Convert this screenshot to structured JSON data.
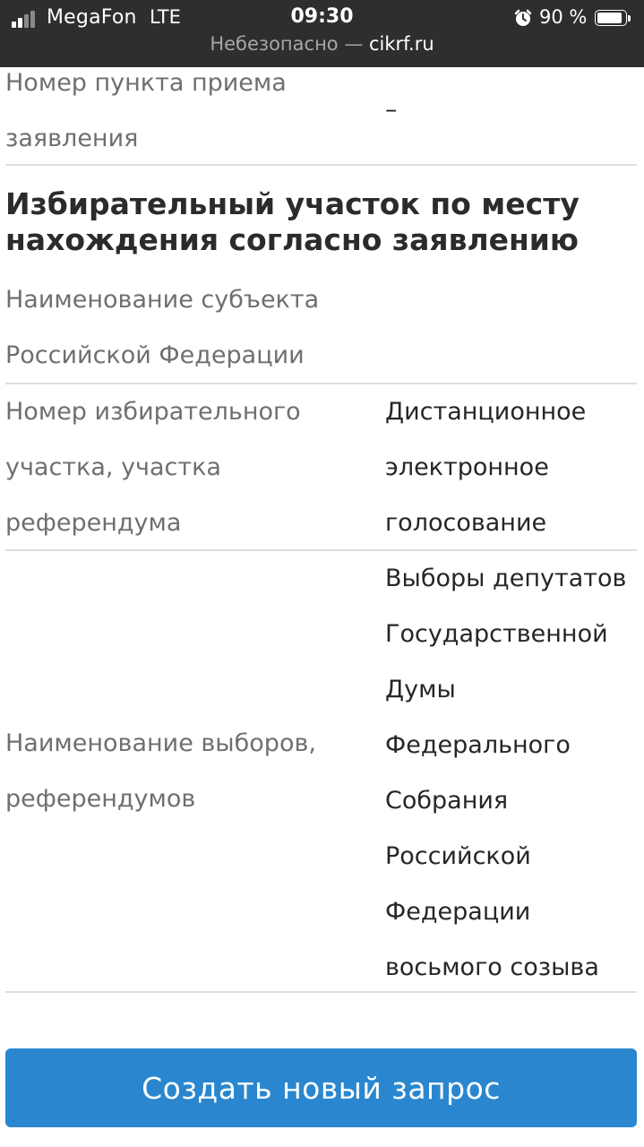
{
  "status_bar": {
    "carrier": "MegaFon",
    "network": "LTE",
    "time": "09:30",
    "battery_percent_text": "90 %",
    "battery_level": 0.9,
    "signal_bars_active": 2,
    "signal_bars_total": 4,
    "icons": [
      "signal-icon",
      "alarm-icon",
      "battery-icon"
    ]
  },
  "url_bar": {
    "security_text": "Небезопасно — ",
    "domain": "cikrf.ru"
  },
  "rows": {
    "pickup_point": {
      "label_line1": "Номер пункта приема",
      "label_line2": "заявления",
      "value": "–"
    },
    "subject": {
      "label_line1": "Наименование субъекта",
      "label_line2": "Российской Федерации"
    },
    "precinct": {
      "label_line1": "Номер избирательного",
      "label_line2": "участка, участка",
      "label_line3": "референдума",
      "value_lines": [
        "Дистанционное",
        "электронное",
        "голосование"
      ]
    },
    "elections": {
      "label_line1": "Наименование выборов,",
      "label_line2": "референдумов",
      "value_lines": [
        "Выборы депутатов",
        "Государственной",
        "Думы",
        "Федерального",
        "Собрания",
        "Российской",
        "Федерации",
        "восьмого созыва"
      ]
    }
  },
  "section": {
    "title_line1": "Избирательный участок по месту",
    "title_line2": "нахождения согласно заявлению"
  },
  "actions": {
    "create_request_label": "Создать новый запрос",
    "button_color": "#2a87cf"
  }
}
